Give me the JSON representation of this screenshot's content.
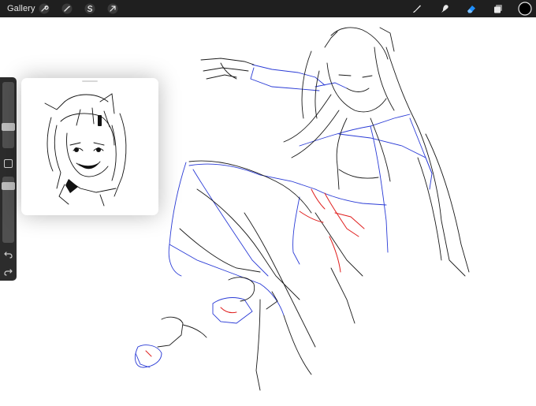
{
  "topbar": {
    "gallery_label": "Gallery",
    "left_tools": [
      "wrench-icon",
      "magic-wand-icon",
      "selection-icon",
      "transform-arrow-icon"
    ],
    "right_tools": [
      "brush-icon",
      "smudge-icon",
      "eraser-icon",
      "layers-icon",
      "color-swatch"
    ],
    "active_tool": "eraser-icon",
    "active_color": "#1f8fff",
    "current_color": "#000000"
  },
  "sidebar": {
    "brush_size": 0.3,
    "opacity": 0.9
  },
  "reference": {
    "visible": true
  },
  "sketch_colors": {
    "line": "#1a1a1a",
    "construction": "#2a3bd6",
    "accent": "#e0201f"
  }
}
